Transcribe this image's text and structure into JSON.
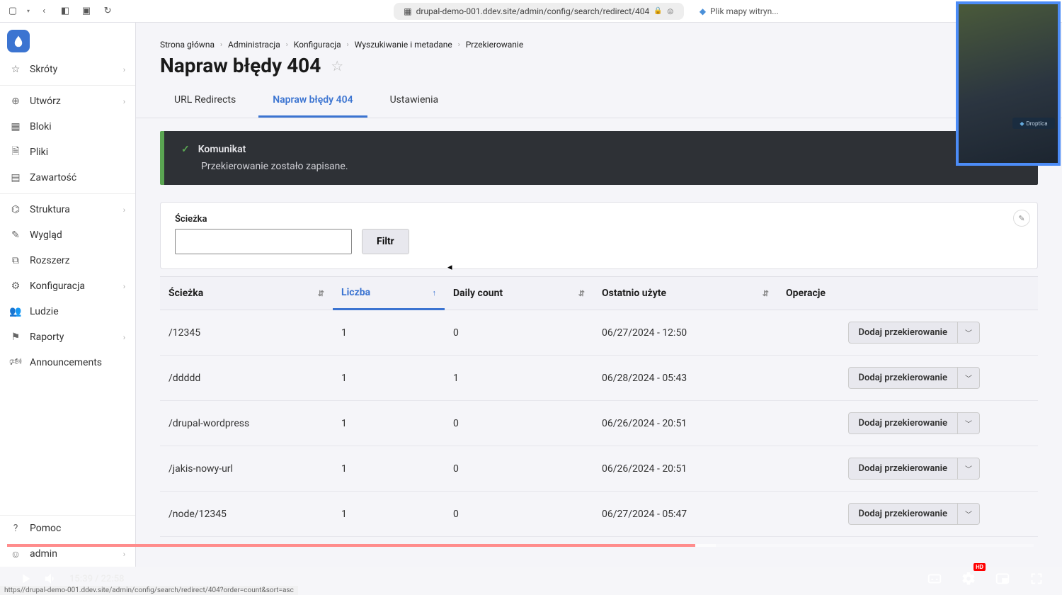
{
  "browser": {
    "url": "drupal-demo-001.ddev.site/admin/config/search/redirect/404",
    "bookmark": "Plik mapy witryn..."
  },
  "sidebar": {
    "items": [
      {
        "label": "Skróty",
        "icon": "star",
        "chev": true
      },
      {
        "label": "Utwórz",
        "icon": "plus",
        "chev": true
      },
      {
        "label": "Bloki",
        "icon": "blocks",
        "chev": false
      },
      {
        "label": "Pliki",
        "icon": "file",
        "chev": false
      },
      {
        "label": "Zawartość",
        "icon": "content",
        "chev": false
      },
      {
        "label": "Struktura",
        "icon": "structure",
        "chev": true
      },
      {
        "label": "Wygląd",
        "icon": "brush",
        "chev": false
      },
      {
        "label": "Rozszerz",
        "icon": "extend",
        "chev": false
      },
      {
        "label": "Konfiguracja",
        "icon": "config",
        "chev": true
      },
      {
        "label": "Ludzie",
        "icon": "people",
        "chev": false
      },
      {
        "label": "Raporty",
        "icon": "reports",
        "chev": true
      },
      {
        "label": "Announcements",
        "icon": "announce",
        "chev": false
      }
    ],
    "bottom": [
      {
        "label": "Pomoc",
        "icon": "help",
        "chev": false
      },
      {
        "label": "admin",
        "icon": "user",
        "chev": true
      }
    ]
  },
  "breadcrumb": [
    "Strona główna",
    "Administracja",
    "Konfiguracja",
    "Wyszukiwanie i metadane",
    "Przekierowanie"
  ],
  "page_title": "Napraw błędy 404",
  "tabs": [
    {
      "label": "URL Redirects",
      "active": false
    },
    {
      "label": "Napraw błędy 404",
      "active": true
    },
    {
      "label": "Ustawienia",
      "active": false
    }
  ],
  "message": {
    "title": "Komunikat",
    "body": "Przekierowanie zostało zapisane."
  },
  "filter": {
    "label": "Ścieżka",
    "value": "",
    "button": "Filtr"
  },
  "table": {
    "headers": {
      "path": "Ścieżka",
      "count": "Liczba",
      "daily": "Daily count",
      "last": "Ostatnio użyte",
      "ops": "Operacje"
    },
    "op_label": "Dodaj przekierowanie",
    "rows": [
      {
        "path": "/12345",
        "count": "1",
        "daily": "0",
        "last": "06/27/2024 - 12:50"
      },
      {
        "path": "/ddddd",
        "count": "1",
        "daily": "1",
        "last": "06/28/2024 - 05:43"
      },
      {
        "path": "/drupal-wordpress",
        "count": "1",
        "daily": "0",
        "last": "06/26/2024 - 20:51"
      },
      {
        "path": "/jakis-nowy-url",
        "count": "1",
        "daily": "0",
        "last": "06/26/2024 - 20:51"
      },
      {
        "path": "/node/12345",
        "count": "1",
        "daily": "0",
        "last": "06/27/2024 - 05:47"
      }
    ]
  },
  "player": {
    "current": "15:39",
    "duration": "22:58",
    "hd": "HD",
    "webcam_badge": "Droptica"
  },
  "status_url": "https//drupal-demo-001.ddev.site/admin/config/search/redirect/404?order=count&sort=asc"
}
